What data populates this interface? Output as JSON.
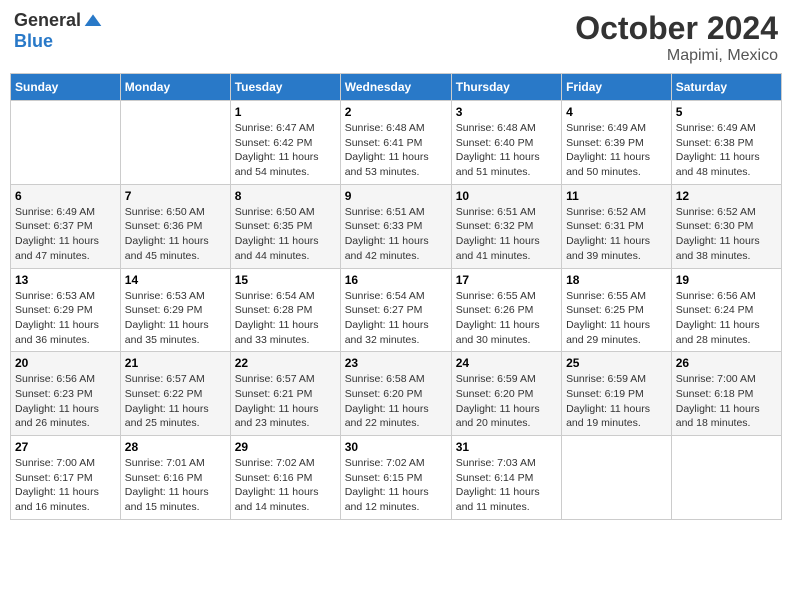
{
  "logo": {
    "general": "General",
    "blue": "Blue"
  },
  "title": "October 2024",
  "location": "Mapimi, Mexico",
  "weekdays": [
    "Sunday",
    "Monday",
    "Tuesday",
    "Wednesday",
    "Thursday",
    "Friday",
    "Saturday"
  ],
  "weeks": [
    [
      {
        "day": "",
        "info": ""
      },
      {
        "day": "",
        "info": ""
      },
      {
        "day": "1",
        "info": "Sunrise: 6:47 AM\nSunset: 6:42 PM\nDaylight: 11 hours and 54 minutes."
      },
      {
        "day": "2",
        "info": "Sunrise: 6:48 AM\nSunset: 6:41 PM\nDaylight: 11 hours and 53 minutes."
      },
      {
        "day": "3",
        "info": "Sunrise: 6:48 AM\nSunset: 6:40 PM\nDaylight: 11 hours and 51 minutes."
      },
      {
        "day": "4",
        "info": "Sunrise: 6:49 AM\nSunset: 6:39 PM\nDaylight: 11 hours and 50 minutes."
      },
      {
        "day": "5",
        "info": "Sunrise: 6:49 AM\nSunset: 6:38 PM\nDaylight: 11 hours and 48 minutes."
      }
    ],
    [
      {
        "day": "6",
        "info": "Sunrise: 6:49 AM\nSunset: 6:37 PM\nDaylight: 11 hours and 47 minutes."
      },
      {
        "day": "7",
        "info": "Sunrise: 6:50 AM\nSunset: 6:36 PM\nDaylight: 11 hours and 45 minutes."
      },
      {
        "day": "8",
        "info": "Sunrise: 6:50 AM\nSunset: 6:35 PM\nDaylight: 11 hours and 44 minutes."
      },
      {
        "day": "9",
        "info": "Sunrise: 6:51 AM\nSunset: 6:33 PM\nDaylight: 11 hours and 42 minutes."
      },
      {
        "day": "10",
        "info": "Sunrise: 6:51 AM\nSunset: 6:32 PM\nDaylight: 11 hours and 41 minutes."
      },
      {
        "day": "11",
        "info": "Sunrise: 6:52 AM\nSunset: 6:31 PM\nDaylight: 11 hours and 39 minutes."
      },
      {
        "day": "12",
        "info": "Sunrise: 6:52 AM\nSunset: 6:30 PM\nDaylight: 11 hours and 38 minutes."
      }
    ],
    [
      {
        "day": "13",
        "info": "Sunrise: 6:53 AM\nSunset: 6:29 PM\nDaylight: 11 hours and 36 minutes."
      },
      {
        "day": "14",
        "info": "Sunrise: 6:53 AM\nSunset: 6:29 PM\nDaylight: 11 hours and 35 minutes."
      },
      {
        "day": "15",
        "info": "Sunrise: 6:54 AM\nSunset: 6:28 PM\nDaylight: 11 hours and 33 minutes."
      },
      {
        "day": "16",
        "info": "Sunrise: 6:54 AM\nSunset: 6:27 PM\nDaylight: 11 hours and 32 minutes."
      },
      {
        "day": "17",
        "info": "Sunrise: 6:55 AM\nSunset: 6:26 PM\nDaylight: 11 hours and 30 minutes."
      },
      {
        "day": "18",
        "info": "Sunrise: 6:55 AM\nSunset: 6:25 PM\nDaylight: 11 hours and 29 minutes."
      },
      {
        "day": "19",
        "info": "Sunrise: 6:56 AM\nSunset: 6:24 PM\nDaylight: 11 hours and 28 minutes."
      }
    ],
    [
      {
        "day": "20",
        "info": "Sunrise: 6:56 AM\nSunset: 6:23 PM\nDaylight: 11 hours and 26 minutes."
      },
      {
        "day": "21",
        "info": "Sunrise: 6:57 AM\nSunset: 6:22 PM\nDaylight: 11 hours and 25 minutes."
      },
      {
        "day": "22",
        "info": "Sunrise: 6:57 AM\nSunset: 6:21 PM\nDaylight: 11 hours and 23 minutes."
      },
      {
        "day": "23",
        "info": "Sunrise: 6:58 AM\nSunset: 6:20 PM\nDaylight: 11 hours and 22 minutes."
      },
      {
        "day": "24",
        "info": "Sunrise: 6:59 AM\nSunset: 6:20 PM\nDaylight: 11 hours and 20 minutes."
      },
      {
        "day": "25",
        "info": "Sunrise: 6:59 AM\nSunset: 6:19 PM\nDaylight: 11 hours and 19 minutes."
      },
      {
        "day": "26",
        "info": "Sunrise: 7:00 AM\nSunset: 6:18 PM\nDaylight: 11 hours and 18 minutes."
      }
    ],
    [
      {
        "day": "27",
        "info": "Sunrise: 7:00 AM\nSunset: 6:17 PM\nDaylight: 11 hours and 16 minutes."
      },
      {
        "day": "28",
        "info": "Sunrise: 7:01 AM\nSunset: 6:16 PM\nDaylight: 11 hours and 15 minutes."
      },
      {
        "day": "29",
        "info": "Sunrise: 7:02 AM\nSunset: 6:16 PM\nDaylight: 11 hours and 14 minutes."
      },
      {
        "day": "30",
        "info": "Sunrise: 7:02 AM\nSunset: 6:15 PM\nDaylight: 11 hours and 12 minutes."
      },
      {
        "day": "31",
        "info": "Sunrise: 7:03 AM\nSunset: 6:14 PM\nDaylight: 11 hours and 11 minutes."
      },
      {
        "day": "",
        "info": ""
      },
      {
        "day": "",
        "info": ""
      }
    ]
  ]
}
